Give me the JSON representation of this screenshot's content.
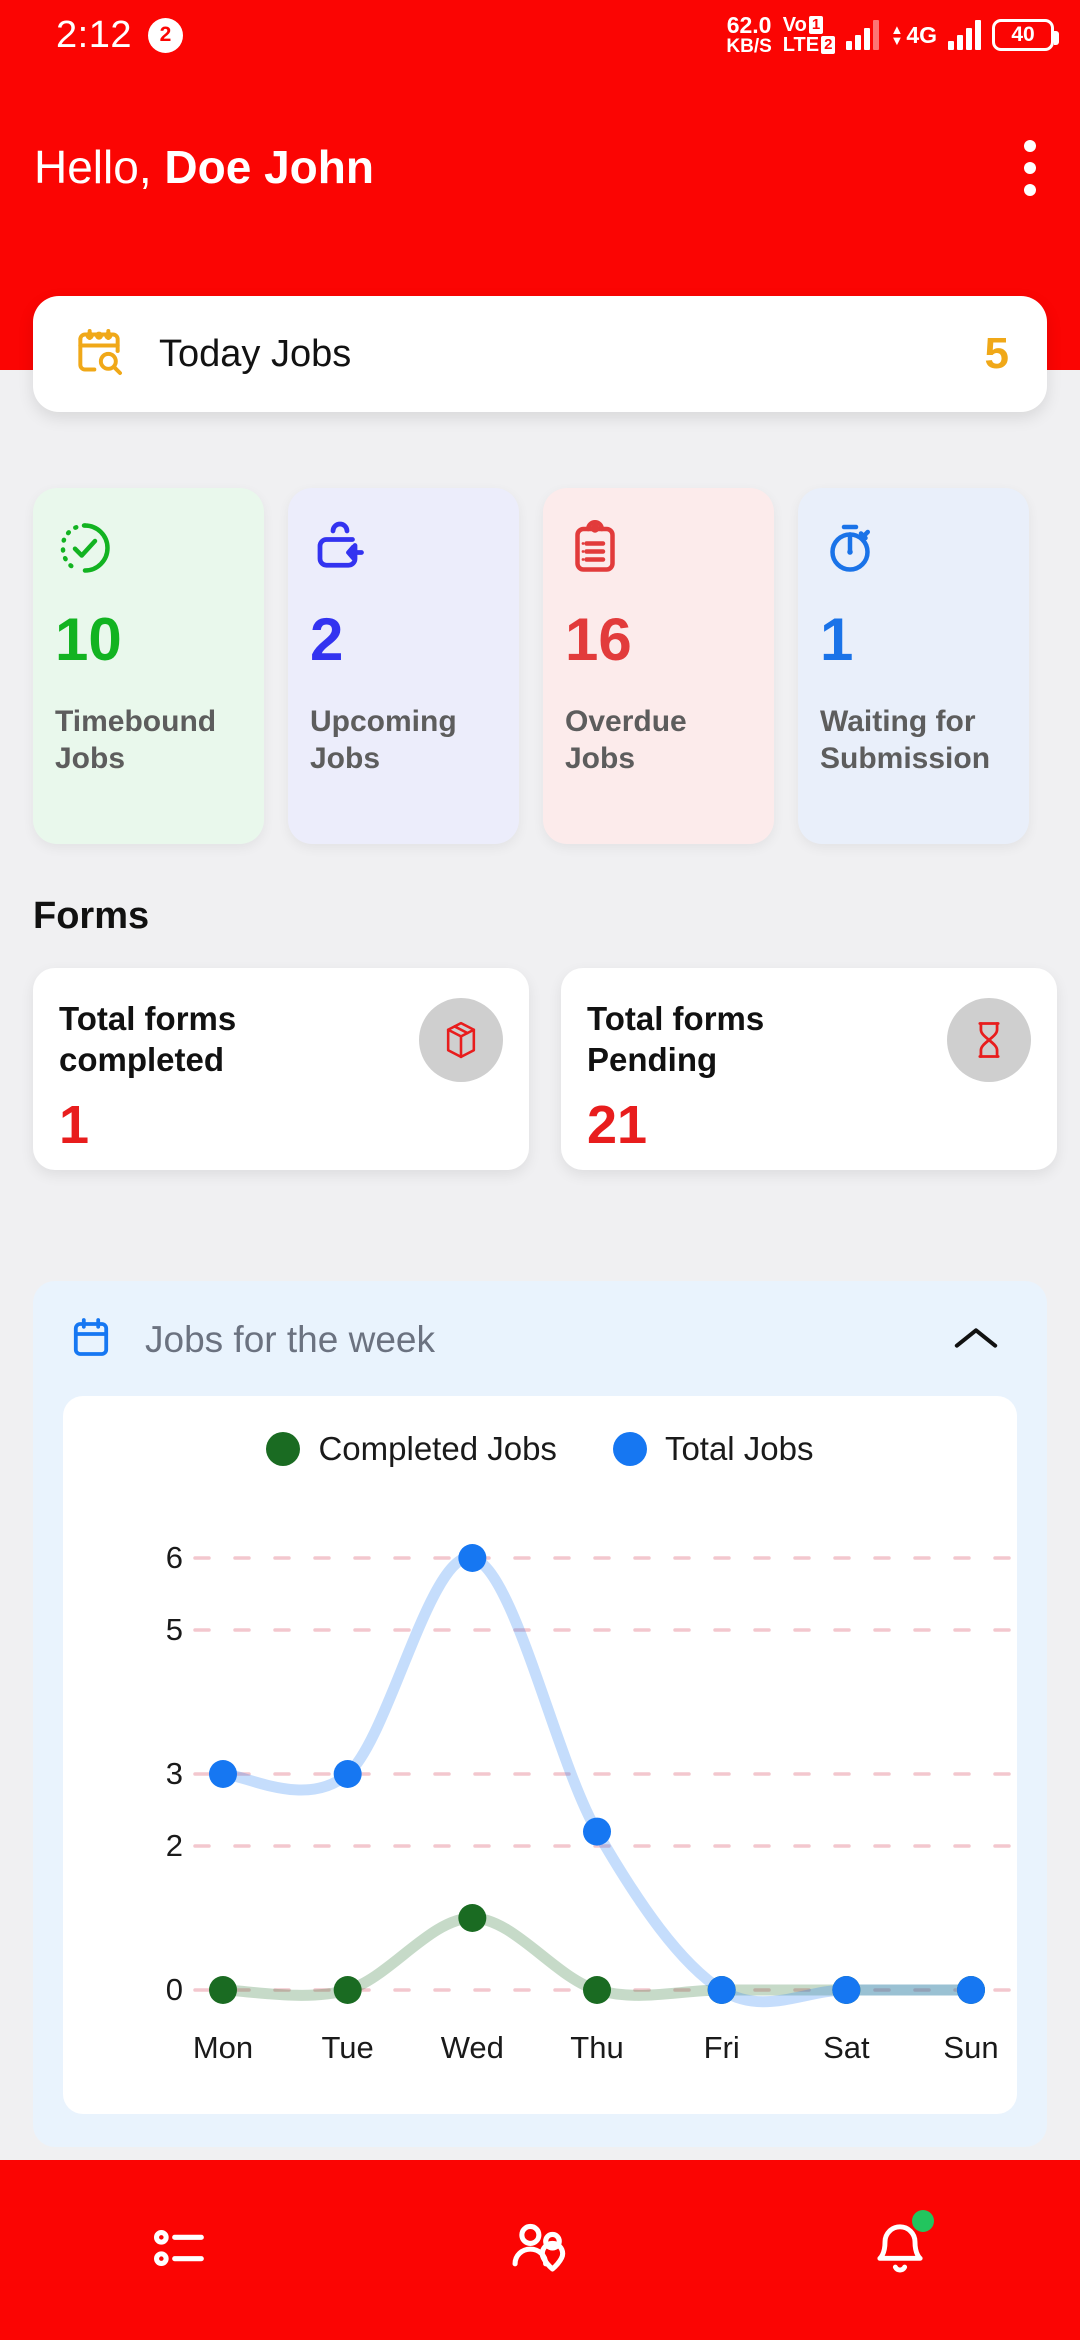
{
  "statusbar": {
    "time": "2:12",
    "notification_count": "2",
    "net_speed_value": "62.0",
    "net_speed_unit": "KB/S",
    "volte_line1": "Vo",
    "volte_line2": "LTE",
    "sim1": "1",
    "sim2": "2",
    "network_type": "4G",
    "battery_percent": "40"
  },
  "header": {
    "greeting_prefix": "Hello,",
    "user_name": "Doe John",
    "menu_icon": "kebab-menu-icon"
  },
  "today_jobs": {
    "icon": "calendar-search-icon",
    "label": "Today Jobs",
    "count": "5",
    "count_color": "#f0a818"
  },
  "stats": [
    {
      "icon": "clock-check-icon",
      "count": "10",
      "label": "Timebound Jobs",
      "bg": "#e9f8ec",
      "accent": "#12b321"
    },
    {
      "icon": "inbox-arrow-icon",
      "count": "2",
      "label": "Upcoming Jobs",
      "bg": "#ecedfb",
      "accent": "#3333f0"
    },
    {
      "icon": "clipboard-list-icon",
      "count": "16",
      "label": "Overdue Jobs",
      "bg": "#fcebeb",
      "accent": "#e23b3b"
    },
    {
      "icon": "stopwatch-icon",
      "count": "1",
      "label": "Waiting for Submission",
      "bg": "#e9effa",
      "accent": "#1a73e8"
    }
  ],
  "forms": {
    "section_title": "Forms",
    "cards": [
      {
        "title": "Total forms completed",
        "value": "1",
        "icon": "package-box-icon",
        "icon_color": "#e81d1d"
      },
      {
        "title": "Total forms Pending",
        "value": "21",
        "icon": "hourglass-icon",
        "icon_color": "#e81d1d"
      }
    ]
  },
  "chart_panel": {
    "icon": "calendar-icon",
    "title": "Jobs for the week",
    "collapse_icon": "chevron-up-icon"
  },
  "chart_data": {
    "type": "line",
    "title": "Jobs for the week",
    "categories": [
      "Mon",
      "Tue",
      "Wed",
      "Thu",
      "Fri",
      "Sat",
      "Sun"
    ],
    "series": [
      {
        "name": "Completed Jobs",
        "color": "#1a6b22",
        "values": [
          0,
          0,
          1,
          0,
          0,
          0,
          0
        ]
      },
      {
        "name": "Total Jobs",
        "color": "#1677f2",
        "values": [
          3,
          3,
          6,
          2.2,
          0,
          0,
          0
        ]
      }
    ],
    "ytick_labels": [
      "0",
      "2",
      "3",
      "5",
      "6"
    ],
    "ytick_values": [
      0,
      2,
      3,
      5,
      6
    ],
    "ylim": [
      0,
      6
    ],
    "xlabel": "",
    "ylabel": "",
    "grid": true,
    "grid_style": "dashed",
    "grid_color": "#f3c7ce",
    "legend_position": "top",
    "smooth": true
  },
  "bottomnav": {
    "items": [
      {
        "icon": "task-list-icon",
        "badge": false
      },
      {
        "icon": "people-location-icon",
        "badge": false
      },
      {
        "icon": "bell-icon",
        "badge": true
      }
    ]
  }
}
